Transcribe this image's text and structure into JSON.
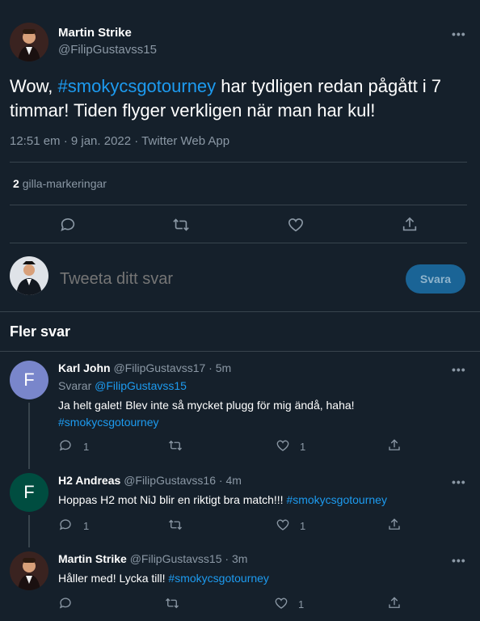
{
  "main_tweet": {
    "author_name": "Martin Strike",
    "author_handle": "@FilipGustavss15",
    "text_before": "Wow, ",
    "hashtag": "#smokycsgotourney",
    "text_after": " har tydligen redan pågått i 7 timmar! Tiden flyger verkligen när man har kul!",
    "meta": "12:51 em · 9 jan. 2022 · Twitter Web App",
    "likes_count": "2",
    "likes_label": "gilla-markeringar"
  },
  "reply_box": {
    "placeholder": "Tweeta ditt svar",
    "button_label": "Svara"
  },
  "more_replies": {
    "heading": "Fler svar",
    "items": [
      {
        "name": "Karl John",
        "handle": "@FilipGustavss17",
        "time": "· 5m",
        "replying_prefix": "Svarar ",
        "replying_to": "@FilipGustavss15",
        "text": "Ja helt galet! Blev inte så mycket plugg för mig ändå, haha!",
        "hashtag": "#smokycsgotourney",
        "avatar_letter": "F",
        "avatar_color": "#7986cb",
        "reply_count": "1",
        "like_count": "1"
      },
      {
        "name": "H2 Andreas",
        "handle": "@FilipGustavss16",
        "time": "· 4m",
        "text": "Hoppas H2 mot NiJ blir en riktigt bra match!!! ",
        "hashtag": "#smokycsgotourney",
        "avatar_letter": "F",
        "avatar_color": "#004d40",
        "reply_count": "1",
        "like_count": "1"
      },
      {
        "name": "Martin Strike",
        "handle": "@FilipGustavss15",
        "time": "· 3m",
        "text": "Håller med! Lycka till! ",
        "hashtag": "#smokycsgotourney",
        "like_count": "1"
      }
    ]
  },
  "colors": {
    "background": "#15202b",
    "accent": "#1d9bf0",
    "muted": "#8b98a5",
    "divider": "#38444d"
  }
}
